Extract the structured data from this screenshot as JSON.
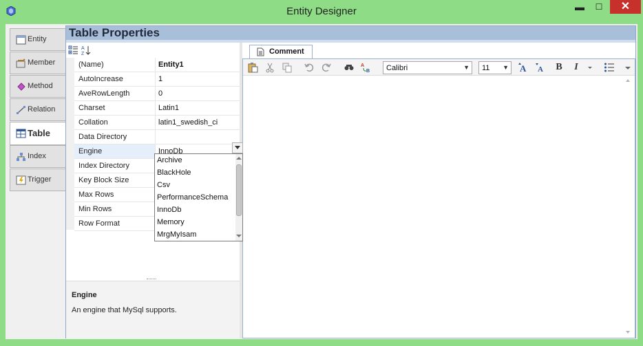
{
  "window": {
    "title": "Entity Designer",
    "close": "✕",
    "minimize": "▬",
    "maximize": "☐"
  },
  "tabs": [
    {
      "label": "Entity",
      "icon": "entity-icon"
    },
    {
      "label": "Member",
      "icon": "member-icon"
    },
    {
      "label": "Method",
      "icon": "method-icon"
    },
    {
      "label": "Relation",
      "icon": "relation-icon"
    },
    {
      "label": "Table",
      "icon": "table-icon",
      "active": true
    },
    {
      "label": "Index",
      "icon": "index-icon"
    },
    {
      "label": "Trigger",
      "icon": "trigger-icon"
    }
  ],
  "panel": {
    "title": "Table Properties"
  },
  "properties": [
    {
      "name": "(Name)",
      "value": "Entity1"
    },
    {
      "name": "AutoIncrease",
      "value": "1"
    },
    {
      "name": "AveRowLength",
      "value": "0"
    },
    {
      "name": "Charset",
      "value": "Latin1"
    },
    {
      "name": "Collation",
      "value": "latin1_swedish_ci"
    },
    {
      "name": "Data Directory",
      "value": ""
    },
    {
      "name": "Engine",
      "value": "InnoDb"
    },
    {
      "name": "Index Directory",
      "value": ""
    },
    {
      "name": "Key Block Size",
      "value": ""
    },
    {
      "name": "Max Rows",
      "value": ""
    },
    {
      "name": "Min Rows",
      "value": ""
    },
    {
      "name": "Row Format",
      "value": ""
    }
  ],
  "engine_options": [
    "Archive",
    "BlackHole",
    "Csv",
    "PerformanceSchema",
    "InnoDb",
    "Memory",
    "MrgMyIsam"
  ],
  "description": {
    "title": "Engine",
    "text": "An engine that MySql supports."
  },
  "comment": {
    "tab_label": "Comment",
    "font": "Calibri",
    "size": "11",
    "buttons": {
      "bold": "B",
      "italic": "I"
    }
  },
  "colors": {
    "window_green": "#8fdc87",
    "panel_header": "#a9bfd9",
    "close_red": "#c7312b"
  }
}
